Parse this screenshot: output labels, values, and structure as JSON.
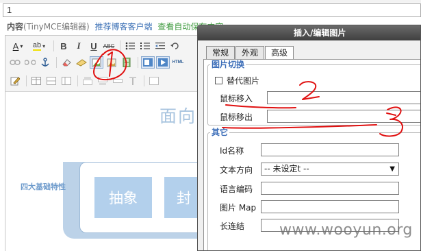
{
  "post": {
    "title_value": "1",
    "content_label": "内容",
    "editor_name": "(TinyMCE编辑器)",
    "recommend_link": "推荐博客客户端",
    "autosave_link": "查看自动保存内容"
  },
  "toolbar": {
    "font_color_label": "A",
    "highlight_label": "ab",
    "bold_label": "B",
    "italic_label": "I",
    "underline_label": "U",
    "strike_label": "ABC",
    "html_label": "HTML"
  },
  "mindmap": {
    "title": "面向",
    "side_label": "四大基础特性",
    "node_1": "抽象",
    "node_2": "封"
  },
  "dialog": {
    "title": "插入/编辑图片",
    "tabs": [
      "常规",
      "外观",
      "高级"
    ],
    "active_tab": "高级",
    "swap_section": {
      "legend": "图片切换",
      "alt_image_label": "替代图片",
      "alt_image_checked": false,
      "mouseover_label": "鼠标移入",
      "mouseover_value": "",
      "mouseout_label": "鼠标移出",
      "mouseout_value": ""
    },
    "other_section": {
      "legend": "其它",
      "id_label": "Id名称",
      "id_value": "",
      "direction_label": "文本方向",
      "direction_value": "-- 未设定t --",
      "lang_label": "语言编码",
      "lang_value": "",
      "map_label": "图片 Map",
      "map_value": "",
      "longdesc_label": "长连结",
      "longdesc_value": ""
    }
  },
  "annotations": [
    "1",
    "2",
    "3"
  ],
  "watermark": "www.wooyun.org",
  "colors": {
    "annotation_red": "#e01010",
    "legend_blue": "#3b6db8",
    "mindmap_blue": "#b3d0ec"
  }
}
